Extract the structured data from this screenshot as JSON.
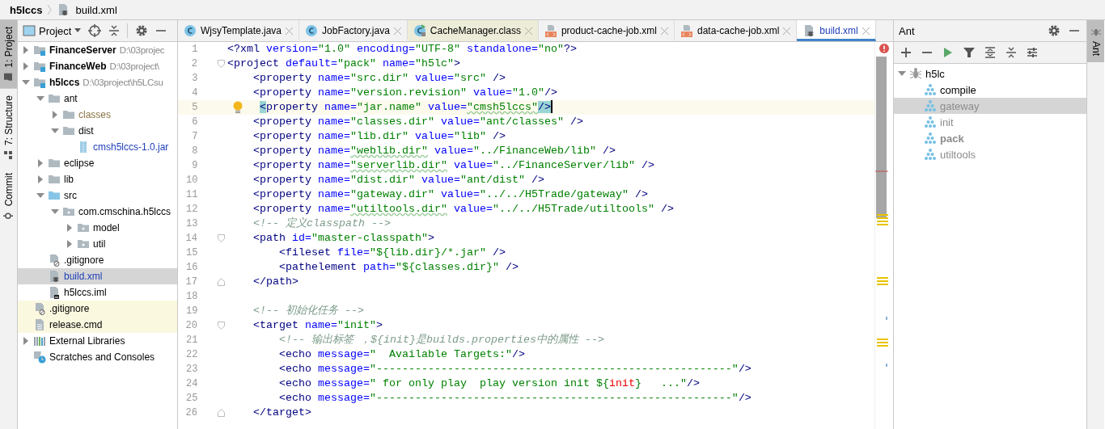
{
  "breadcrumb": [
    {
      "label": "h5lccs",
      "kind": "module"
    },
    {
      "label": "build.xml",
      "kind": "ant"
    }
  ],
  "left_tool_windows": [
    {
      "label": "1: Project",
      "kind": "project",
      "selected": true
    },
    {
      "label": "7: Structure",
      "kind": "structure",
      "selected": false
    },
    {
      "label": "Commit",
      "kind": "commit",
      "selected": false
    }
  ],
  "project_panel": {
    "title": "Project",
    "tree": [
      {
        "label": "FinanceServer",
        "hint": "D:\\03projec",
        "kind": "module",
        "expanded": false,
        "selected": false
      },
      {
        "label": "FinanceWeb",
        "hint": "D:\\03project\\",
        "kind": "module",
        "expanded": false,
        "selected": false
      },
      {
        "label": "h5lccs",
        "hint": "D:\\03project\\h5LCsu",
        "kind": "module",
        "expanded": true,
        "selected": false,
        "children": [
          {
            "label": "ant",
            "kind": "folder",
            "expanded": true,
            "selected": false,
            "children": [
              {
                "label": "classes",
                "kind": "folder",
                "expanded": false,
                "selected": false,
                "excluded": true
              },
              {
                "label": "dist",
                "kind": "folder",
                "expanded": true,
                "selected": false,
                "children": [
                  {
                    "label": "cmsh5lccs-1.0.jar",
                    "kind": "jar",
                    "selected": false,
                    "modified": true
                  }
                ]
              }
            ]
          },
          {
            "label": "eclipse",
            "kind": "folder",
            "expanded": false,
            "selected": false
          },
          {
            "label": "lib",
            "kind": "folder",
            "expanded": false,
            "selected": false
          },
          {
            "label": "src",
            "kind": "source",
            "expanded": true,
            "selected": false,
            "children": [
              {
                "label": "com.cmschina.h5lccs",
                "kind": "package",
                "expanded": true,
                "selected": false,
                "children": [
                  {
                    "label": "model",
                    "kind": "package",
                    "expanded": false,
                    "selected": false
                  },
                  {
                    "label": "util",
                    "kind": "package",
                    "expanded": false,
                    "selected": false
                  }
                ]
              }
            ]
          },
          {
            "label": ".gitignore",
            "kind": "ignore",
            "selected": false
          },
          {
            "label": "build.xml",
            "kind": "ant",
            "selected": true,
            "modified": true
          },
          {
            "label": "h5lccs.iml",
            "kind": "iml",
            "selected": false
          }
        ]
      },
      {
        "label": ".gitignore",
        "kind": "ignore",
        "selected": false,
        "unversioned": true
      },
      {
        "label": "release.cmd",
        "kind": "text",
        "selected": false,
        "unversioned": true
      },
      {
        "label": "External Libraries",
        "kind": "libraries",
        "expanded": false,
        "selected": false
      },
      {
        "label": "Scratches and Consoles",
        "kind": "scratches",
        "selected": false
      }
    ]
  },
  "editor_tabs": [
    {
      "label": "WjsyTemplate.java",
      "kind": "java",
      "selected": false,
      "library": false
    },
    {
      "label": "JobFactory.java",
      "kind": "java",
      "selected": false,
      "library": false
    },
    {
      "label": "CacheManager.class",
      "kind": "class",
      "selected": false,
      "library": true
    },
    {
      "label": "product-cache-job.xml",
      "kind": "xml",
      "selected": false,
      "library": false
    },
    {
      "label": "data-cache-job.xml",
      "kind": "xml",
      "selected": false,
      "library": false
    },
    {
      "label": "build.xml",
      "kind": "ant",
      "selected": true,
      "library": false
    }
  ],
  "editor": {
    "has_error": true,
    "lines": [
      {
        "number": "1",
        "current": false,
        "tokens": [
          {
            "kind": "tag",
            "text": "<?xml"
          },
          {
            "kind": "attr",
            "text": " version="
          },
          {
            "kind": "value",
            "text": "\"1.0\""
          },
          {
            "kind": "attr",
            "text": " encoding="
          },
          {
            "kind": "value",
            "text": "\"UTF-8\""
          },
          {
            "kind": "attr",
            "text": " standalone="
          },
          {
            "kind": "value",
            "text": "\"no\""
          },
          {
            "kind": "tag",
            "text": "?>"
          }
        ]
      },
      {
        "number": "2",
        "current": false,
        "fold_start": true,
        "tokens": [
          {
            "kind": "tag",
            "text": "<project"
          },
          {
            "kind": "attr",
            "text": " default="
          },
          {
            "kind": "value",
            "text": "\"pack\""
          },
          {
            "kind": "attr",
            "text": " name="
          },
          {
            "kind": "value",
            "text": "\"h5lc\""
          },
          {
            "kind": "tag",
            "text": ">"
          }
        ]
      },
      {
        "number": "3",
        "current": false,
        "tokens": [
          {
            "kind": "tag",
            "text": "    <property"
          },
          {
            "kind": "attr",
            "text": " name="
          },
          {
            "kind": "value",
            "text": "\"src.dir\""
          },
          {
            "kind": "attr",
            "text": " value="
          },
          {
            "kind": "value",
            "text": "\"src\""
          },
          {
            "kind": "tag",
            "text": " />"
          }
        ]
      },
      {
        "number": "4",
        "current": false,
        "tokens": [
          {
            "kind": "tag",
            "text": "    <property"
          },
          {
            "kind": "attr",
            "text": " name="
          },
          {
            "kind": "value",
            "text": "\"version.revision\""
          },
          {
            "kind": "attr",
            "text": " value="
          },
          {
            "kind": "value",
            "text": "\"1.0\""
          },
          {
            "kind": "tag",
            "text": "/>"
          }
        ]
      },
      {
        "number": "5",
        "current": true,
        "intention": true,
        "tokens": [
          {
            "kind": "tag",
            "text": "     <",
            "match": true
          },
          {
            "kind": "tag",
            "text": "property"
          },
          {
            "kind": "attr",
            "text": " name="
          },
          {
            "kind": "value",
            "text": "\"jar.name\""
          },
          {
            "kind": "attr",
            "text": " value="
          },
          {
            "kind": "value",
            "text": "\"cmsh5lccs\"",
            "typo": true
          },
          {
            "kind": "tag",
            "text": "/>",
            "match": true
          }
        ]
      },
      {
        "number": "6",
        "current": false,
        "tokens": [
          {
            "kind": "tag",
            "text": "    <property"
          },
          {
            "kind": "attr",
            "text": " name="
          },
          {
            "kind": "value",
            "text": "\"classes.dir\""
          },
          {
            "kind": "attr",
            "text": " value="
          },
          {
            "kind": "value",
            "text": "\"ant/classes\""
          },
          {
            "kind": "tag",
            "text": " />"
          }
        ]
      },
      {
        "number": "7",
        "current": false,
        "tokens": [
          {
            "kind": "tag",
            "text": "    <property"
          },
          {
            "kind": "attr",
            "text": " name="
          },
          {
            "kind": "value",
            "text": "\"lib.dir\""
          },
          {
            "kind": "attr",
            "text": " value="
          },
          {
            "kind": "value",
            "text": "\"lib\""
          },
          {
            "kind": "tag",
            "text": " />"
          }
        ]
      },
      {
        "number": "8",
        "current": false,
        "tokens": [
          {
            "kind": "tag",
            "text": "    <property"
          },
          {
            "kind": "attr",
            "text": " name="
          },
          {
            "kind": "value",
            "text": "\"weblib.dir\"",
            "typo": true
          },
          {
            "kind": "attr",
            "text": " value="
          },
          {
            "kind": "value",
            "text": "\"../FinanceWeb/lib\""
          },
          {
            "kind": "tag",
            "text": " />"
          }
        ]
      },
      {
        "number": "9",
        "current": false,
        "tokens": [
          {
            "kind": "tag",
            "text": "    <property"
          },
          {
            "kind": "attr",
            "text": " name="
          },
          {
            "kind": "value",
            "text": "\"serverlib.dir\"",
            "typo": true
          },
          {
            "kind": "attr",
            "text": " value="
          },
          {
            "kind": "value",
            "text": "\"../FinanceServer/lib\""
          },
          {
            "kind": "tag",
            "text": " />"
          }
        ]
      },
      {
        "number": "10",
        "current": false,
        "tokens": [
          {
            "kind": "tag",
            "text": "    <property"
          },
          {
            "kind": "attr",
            "text": " name="
          },
          {
            "kind": "value",
            "text": "\"dist.dir\""
          },
          {
            "kind": "attr",
            "text": " value="
          },
          {
            "kind": "value",
            "text": "\"ant/dist\""
          },
          {
            "kind": "tag",
            "text": " />"
          }
        ]
      },
      {
        "number": "11",
        "current": false,
        "tokens": [
          {
            "kind": "tag",
            "text": "    <property"
          },
          {
            "kind": "attr",
            "text": " name="
          },
          {
            "kind": "value",
            "text": "\"gateway.dir\""
          },
          {
            "kind": "attr",
            "text": " value="
          },
          {
            "kind": "value",
            "text": "\"../../H5Trade/gateway\""
          },
          {
            "kind": "tag",
            "text": " />"
          }
        ]
      },
      {
        "number": "12",
        "current": false,
        "tokens": [
          {
            "kind": "tag",
            "text": "    <property"
          },
          {
            "kind": "attr",
            "text": " name="
          },
          {
            "kind": "value",
            "text": "\"utiltools.dir\"",
            "typo": true
          },
          {
            "kind": "attr",
            "text": " value="
          },
          {
            "kind": "value",
            "text": "\"../../H5Trade/utiltools\""
          },
          {
            "kind": "tag",
            "text": " />"
          }
        ]
      },
      {
        "number": "13",
        "current": false,
        "tokens": [
          {
            "kind": "comment",
            "text": "    <!-- 定义classpath -->"
          }
        ]
      },
      {
        "number": "14",
        "current": false,
        "fold_start": true,
        "tokens": [
          {
            "kind": "tag",
            "text": "    <path"
          },
          {
            "kind": "attr",
            "text": " id="
          },
          {
            "kind": "value",
            "text": "\"master-classpath\""
          },
          {
            "kind": "tag",
            "text": ">"
          }
        ]
      },
      {
        "number": "15",
        "current": false,
        "tokens": [
          {
            "kind": "tag",
            "text": "        <fileset"
          },
          {
            "kind": "attr",
            "text": " file="
          },
          {
            "kind": "value",
            "text": "\"${lib.dir}/*.jar\""
          },
          {
            "kind": "tag",
            "text": " />"
          }
        ]
      },
      {
        "number": "16",
        "current": false,
        "tokens": [
          {
            "kind": "tag",
            "text": "        <pathelement"
          },
          {
            "kind": "attr",
            "text": " path="
          },
          {
            "kind": "value",
            "text": "\"${classes.dir}\""
          },
          {
            "kind": "tag",
            "text": " />"
          }
        ]
      },
      {
        "number": "17",
        "current": false,
        "fold_end": true,
        "tokens": [
          {
            "kind": "tag",
            "text": "    </path>"
          }
        ]
      },
      {
        "number": "18",
        "current": false
      },
      {
        "number": "19",
        "current": false,
        "tokens": [
          {
            "kind": "comment",
            "text": "    <!-- 初始化任务 -->"
          }
        ]
      },
      {
        "number": "20",
        "current": false,
        "fold_start": true,
        "tokens": [
          {
            "kind": "tag",
            "text": "    <target"
          },
          {
            "kind": "attr",
            "text": " name="
          },
          {
            "kind": "value",
            "text": "\"init\""
          },
          {
            "kind": "tag",
            "text": ">"
          }
        ]
      },
      {
        "number": "21",
        "current": false,
        "tokens": [
          {
            "kind": "comment",
            "text": "        <!-- 输出标签 ，${init}是builds.properties中的属性 -->"
          }
        ]
      },
      {
        "number": "22",
        "current": false,
        "tokens": [
          {
            "kind": "tag",
            "text": "        <echo"
          },
          {
            "kind": "attr",
            "text": " message="
          },
          {
            "kind": "value",
            "text": "\"  Available Targets:\""
          },
          {
            "kind": "tag",
            "text": "/>"
          }
        ]
      },
      {
        "number": "23",
        "current": false,
        "tokens": [
          {
            "kind": "tag",
            "text": "        <echo"
          },
          {
            "kind": "attr",
            "text": " message="
          },
          {
            "kind": "value",
            "text": "\"-------------------------------------------------------\""
          },
          {
            "kind": "tag",
            "text": "/>"
          }
        ]
      },
      {
        "number": "24",
        "current": false,
        "tokens": [
          {
            "kind": "tag",
            "text": "        <echo"
          },
          {
            "kind": "attr",
            "text": " message="
          },
          {
            "kind": "value",
            "text": "\" for only play  play version init ${"
          },
          {
            "kind": "error",
            "text": "init"
          },
          {
            "kind": "value",
            "text": "}   ...\""
          },
          {
            "kind": "tag",
            "text": "/>"
          }
        ]
      },
      {
        "number": "25",
        "current": false,
        "tokens": [
          {
            "kind": "tag",
            "text": "        <echo"
          },
          {
            "kind": "attr",
            "text": " message="
          },
          {
            "kind": "value",
            "text": "\"-------------------------------------------------------\""
          },
          {
            "kind": "tag",
            "text": "/>"
          }
        ]
      },
      {
        "number": "26",
        "current": false,
        "fold_end": true,
        "tokens": [
          {
            "kind": "tag",
            "text": "    </target>"
          }
        ]
      }
    ]
  },
  "ant_panel": {
    "title": "Ant",
    "tree": [
      {
        "label": "h5lc",
        "expanded": true,
        "selected": false,
        "children": [
          {
            "label": "compile",
            "selected": false,
            "default": false,
            "described": true
          },
          {
            "label": "gateway",
            "selected": true,
            "default": false,
            "described": false
          },
          {
            "label": "init",
            "selected": false,
            "default": false,
            "described": false
          },
          {
            "label": "pack",
            "selected": false,
            "default": true,
            "described": false
          },
          {
            "label": "utiltools",
            "selected": false,
            "default": false,
            "described": false
          }
        ]
      }
    ]
  },
  "right_tool_windows": [
    {
      "label": "Ant",
      "kind": "ant",
      "selected": true
    }
  ]
}
